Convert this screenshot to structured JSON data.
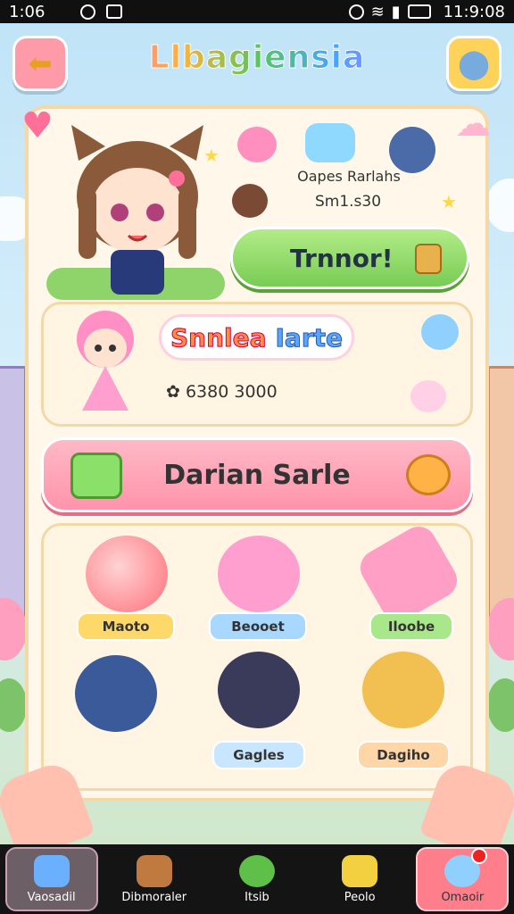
{
  "status_bar": {
    "time": "1:06",
    "clock": "11:9:08"
  },
  "header": {
    "title": "Llbagiensia"
  },
  "companion": {
    "pets_name": "Oapes Rarlahs",
    "pets_sub": "Sm1.s30",
    "treat_label": "Trnnor!"
  },
  "featured": {
    "title_word1": "Snnlea",
    "title_word2": "Iarte",
    "sub": "6380 3000"
  },
  "big_button": {
    "label": "Darian Sarle"
  },
  "items": [
    {
      "label": "Maoto",
      "color": "#ffd86a"
    },
    {
      "label": "Beooet",
      "color": "#a8d8ff"
    },
    {
      "label": "Iloobe",
      "color": "#a8e88a"
    },
    {
      "label": "Gagles",
      "color": "#c8e6ff"
    },
    {
      "label": "Dagiho",
      "color": "#ffd6a8"
    }
  ],
  "nav": [
    {
      "label": "Vaosadil"
    },
    {
      "label": "Dibmoraler"
    },
    {
      "label": "Itsib"
    },
    {
      "label": "Peolo"
    },
    {
      "label": "Omaoir"
    }
  ]
}
